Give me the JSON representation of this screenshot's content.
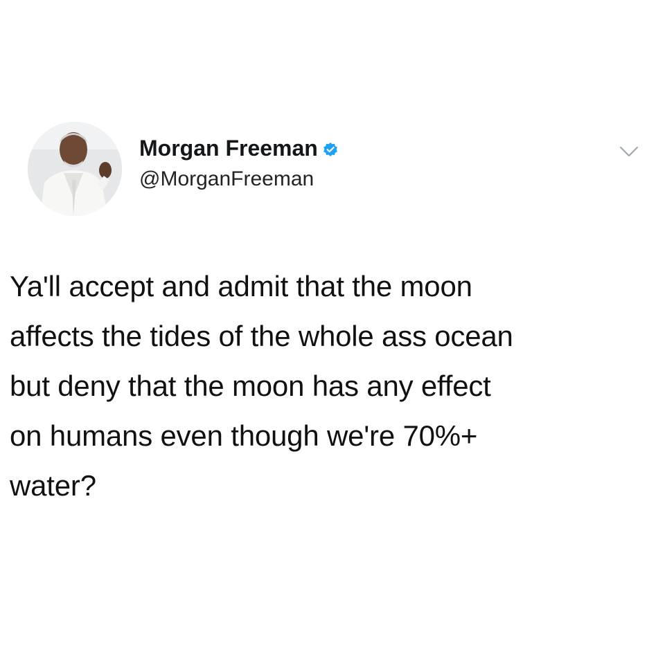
{
  "tweet": {
    "author": {
      "display_name": "Morgan Freeman",
      "handle": "@MorganFreeman",
      "verified": true,
      "avatar_icon": "profile-photo",
      "verified_color": "#1da1f2"
    },
    "menu_icon": "chevron-down-icon",
    "text": "Ya'll accept and admit that the moon\naffects the tides of the whole ass ocean\nbut deny that the moon has any effect\non humans even though we're 70%+\nwater?"
  }
}
